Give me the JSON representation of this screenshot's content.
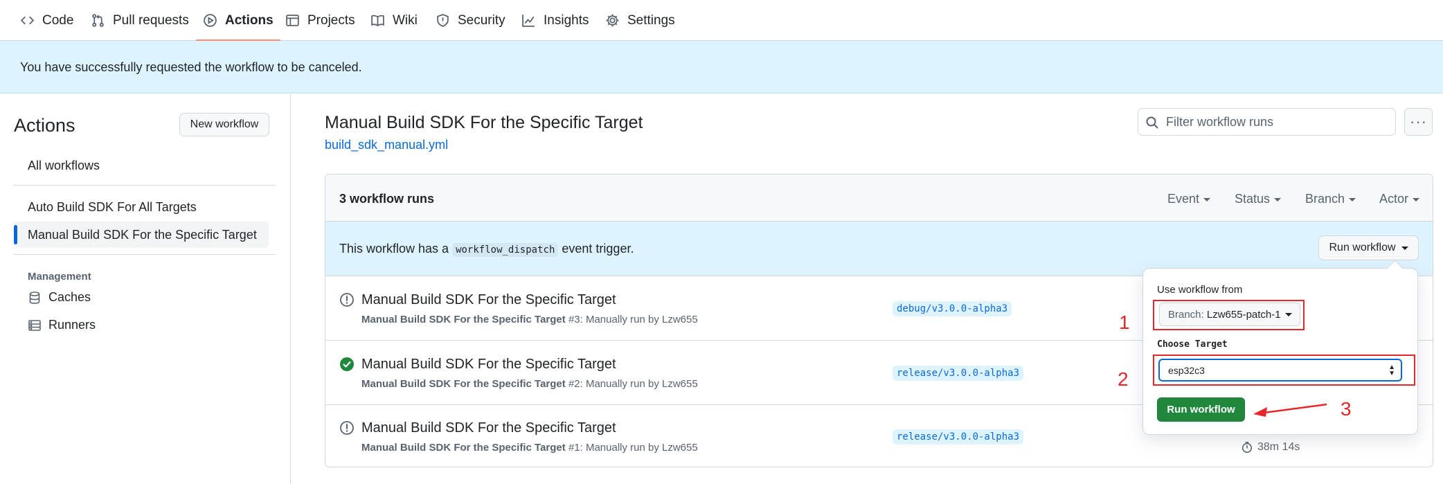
{
  "repo_nav": {
    "tabs": [
      {
        "label": "Code",
        "icon": "code-icon"
      },
      {
        "label": "Pull requests",
        "icon": "git-pull-request-icon"
      },
      {
        "label": "Actions",
        "icon": "play-icon",
        "selected": true
      },
      {
        "label": "Projects",
        "icon": "table-icon"
      },
      {
        "label": "Wiki",
        "icon": "book-icon"
      },
      {
        "label": "Security",
        "icon": "shield-icon"
      },
      {
        "label": "Insights",
        "icon": "graph-icon"
      },
      {
        "label": "Settings",
        "icon": "gear-icon"
      }
    ]
  },
  "flash": {
    "message": "You have successfully requested the workflow to be canceled."
  },
  "sidebar": {
    "title": "Actions",
    "new_workflow_label": "New workflow",
    "all_workflows": "All workflows",
    "workflows": [
      {
        "label": "Auto Build SDK For All Targets"
      },
      {
        "label": "Manual Build SDK For the Specific Target",
        "active": true
      }
    ],
    "management_heading": "Management",
    "management_items": [
      {
        "label": "Caches",
        "icon": "database-icon"
      },
      {
        "label": "Runners",
        "icon": "server-icon"
      }
    ]
  },
  "main": {
    "title": "Manual Build SDK For the Specific Target",
    "file": "build_sdk_manual.yml",
    "filter_placeholder": "Filter workflow runs",
    "kebab": "···",
    "runs_count": "3 workflow runs",
    "header_filters": [
      "Event",
      "Status",
      "Branch",
      "Actor"
    ],
    "dispatch": {
      "text_before": "This workflow has a",
      "code": "workflow_dispatch",
      "text_after": "event trigger.",
      "run_button": "Run workflow"
    },
    "runs": [
      {
        "status": "canceled",
        "title": "Manual Build SDK For the Specific Target",
        "meta_bold": "Manual Build SDK For the Specific Target",
        "meta_rest": "#3: Manually run by Lzw655",
        "branch": "debug/v3.0.0-alpha3"
      },
      {
        "status": "success",
        "title": "Manual Build SDK For the Specific Target",
        "meta_bold": "Manual Build SDK For the Specific Target",
        "meta_rest": "#2: Manually run by Lzw655",
        "branch": "release/v3.0.0-alpha3"
      },
      {
        "status": "canceled",
        "title": "Manual Build SDK For the Specific Target",
        "meta_bold": "Manual Build SDK For the Specific Target",
        "meta_rest": "#1: Manually run by Lzw655",
        "branch": "release/v3.0.0-alpha3",
        "duration": "38m 14s",
        "row_kebab": "···"
      }
    ]
  },
  "popover": {
    "use_workflow_from": "Use workflow from",
    "branch_prefix": "Branch:",
    "branch_value": "Lzw655-patch-1",
    "choose_target_label": "Choose Target",
    "target_value": "esp32c3",
    "run_button": "Run workflow"
  },
  "annotations": [
    "1",
    "2",
    "3"
  ],
  "colors": {
    "accent_blue": "#0969da",
    "success_green": "#1f883d",
    "flash_bg": "#ddf4ff",
    "annotation_red": "#e5262a",
    "tab_underline": "#fd8c73"
  }
}
